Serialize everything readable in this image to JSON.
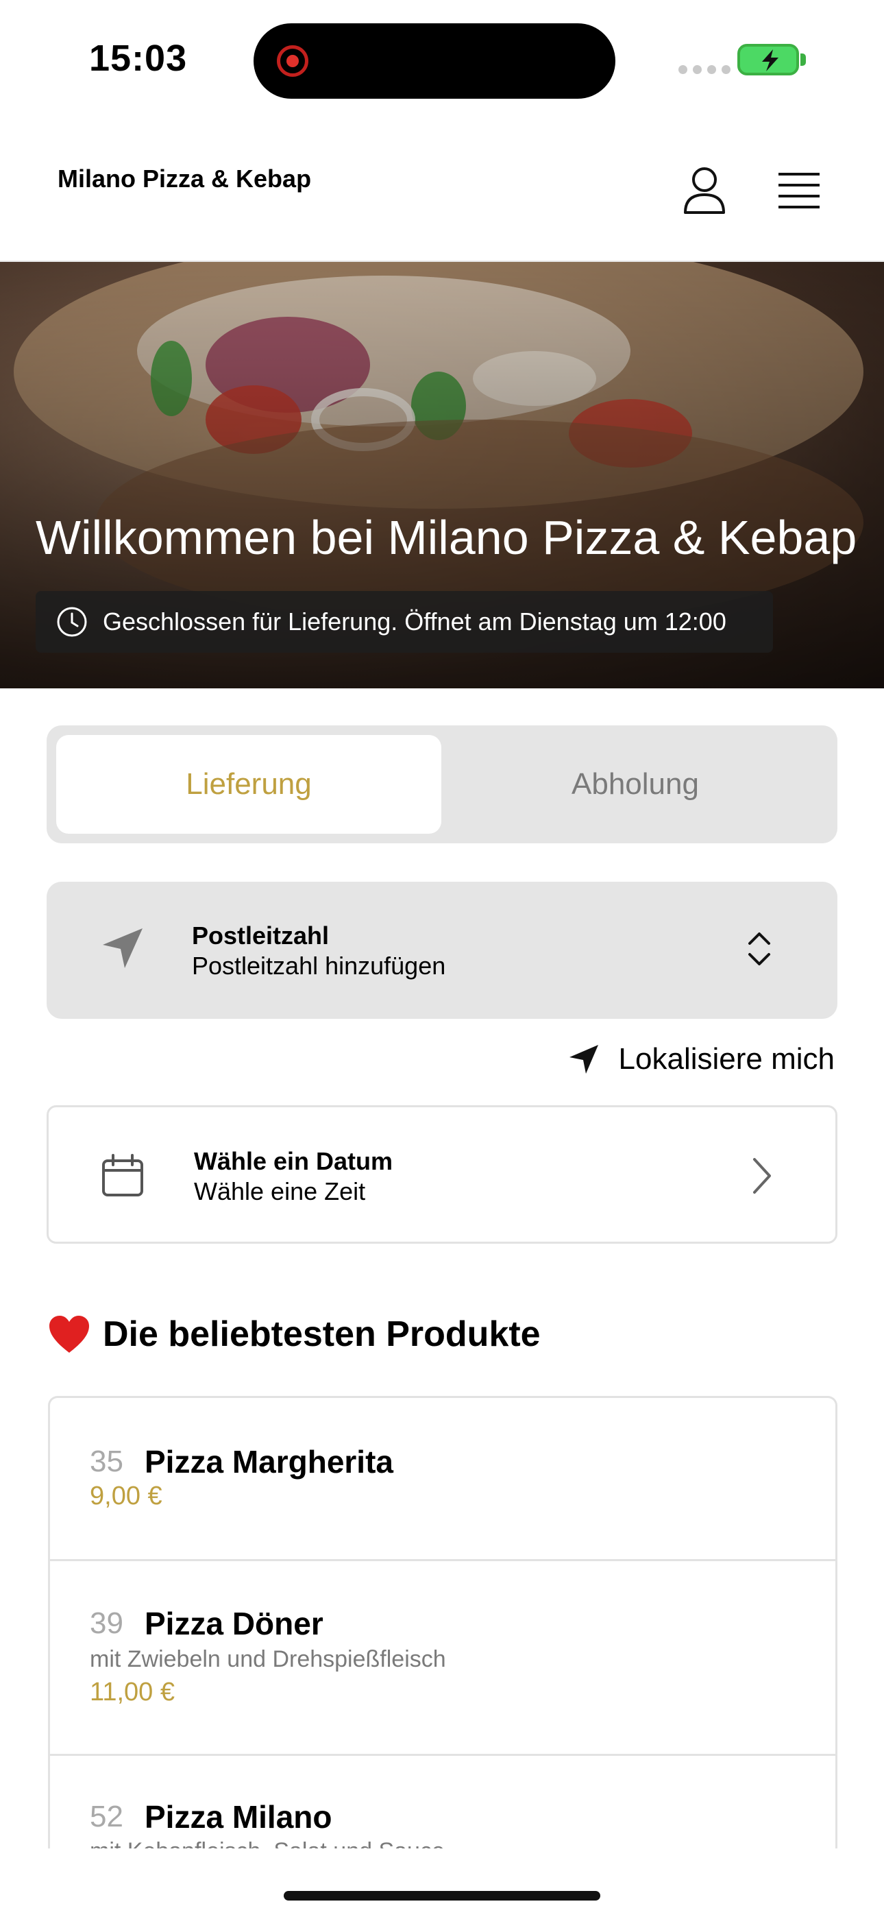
{
  "status_bar": {
    "time": "15:03"
  },
  "header": {
    "brand": "Milano Pizza & Kebap"
  },
  "hero": {
    "title": "Willkommen bei Milano Pizza & Kebap",
    "status": "Geschlossen für Lieferung. Öffnet am Dienstag um 12:00"
  },
  "tabs": [
    {
      "label": "Lieferung",
      "active": true
    },
    {
      "label": "Abholung",
      "active": false
    }
  ],
  "postcode": {
    "label": "Postleitzahl",
    "value": "Postleitzahl hinzufügen"
  },
  "locate": {
    "label": "Lokalisiere mich"
  },
  "date": {
    "label": "Wähle ein Datum",
    "value": "Wähle eine Zeit"
  },
  "section": {
    "title": "Die beliebtesten Produkte"
  },
  "products": [
    {
      "number": "35",
      "name": "Pizza Margherita",
      "description": "",
      "price": "9,00 €"
    },
    {
      "number": "39",
      "name": "Pizza Döner",
      "description": "mit Zwiebeln und Drehspießfleisch",
      "price": "11,00 €"
    },
    {
      "number": "52",
      "name": "Pizza Milano",
      "description": "mit Kebapfleisch, Salat und Sauce",
      "price": ""
    }
  ],
  "colors": {
    "accent": "#bfa040",
    "panel": "#e5e5e5",
    "border": "#e2e2e2"
  },
  "icons": [
    "record-icon",
    "battery-icon",
    "user-icon",
    "menu-icon",
    "clock-icon",
    "navigation-arrow-icon",
    "updown-icon",
    "location-arrow-icon",
    "calendar-icon",
    "chevron-right-icon",
    "heart-icon"
  ]
}
